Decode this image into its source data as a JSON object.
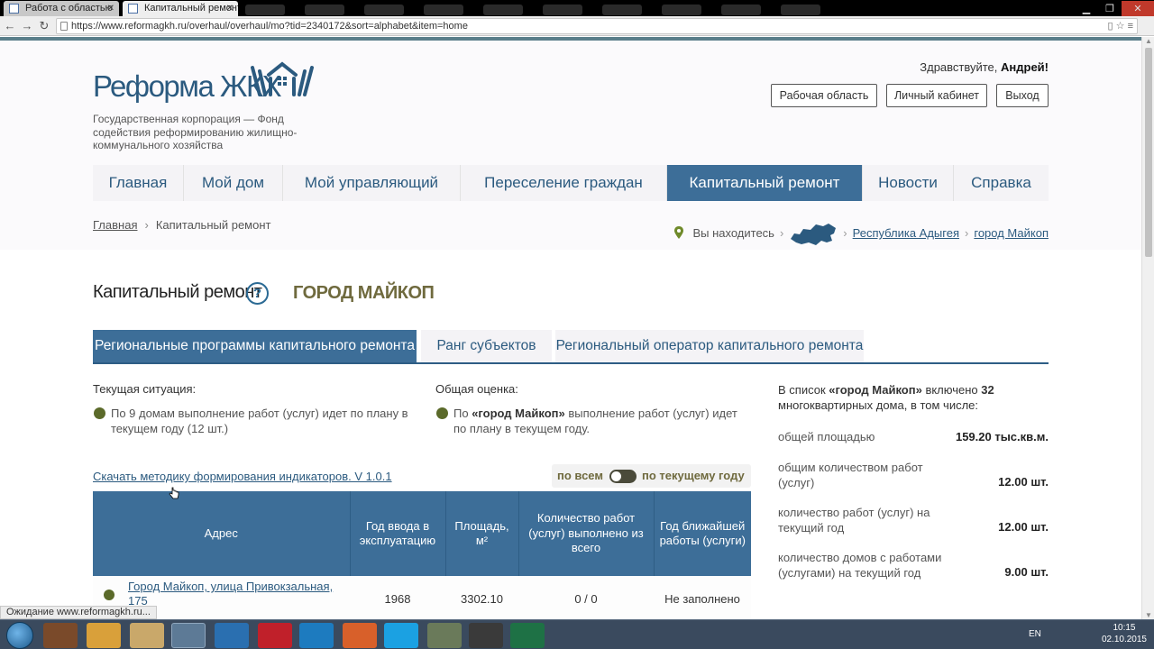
{
  "browser": {
    "tabs": [
      {
        "label": "Работа с областью",
        "active": false
      },
      {
        "label": "Капитальный ремонт",
        "active": true
      }
    ],
    "url": "https://www.reformagkh.ru/overhaul/overhaul/mo?tid=2340172&sort=alphabet&item=home",
    "status_text": "Ожидание www.reformagkh.ru..."
  },
  "header": {
    "logo_text": "Реформа ЖКХ",
    "tagline": "Государственная корпорация — Фонд содействия реформированию жилищно-коммунального хозяйства",
    "greeting_prefix": "Здравствуйте, ",
    "greeting_name": "Андрей!",
    "buttons": {
      "workspace": "Рабочая область",
      "cabinet": "Личный кабинет",
      "logout": "Выход"
    }
  },
  "nav": {
    "items": [
      "Главная",
      "Мой дом",
      "Мой управляющий",
      "Переселение граждан",
      "Капитальный ремонт",
      "Новости",
      "Справка"
    ],
    "active_index": 4
  },
  "breadcrumb": {
    "home": "Главная",
    "current": "Капитальный ремонт"
  },
  "location": {
    "label": "Вы находитесь",
    "region": "Республика Адыгея",
    "city": "город Майкоп"
  },
  "page": {
    "title": "Капитальный ремонт",
    "help_symbol": "?",
    "city_title": "ГОРОД МАЙКОП"
  },
  "tabs": [
    "Региональные программы капитального ремонта",
    "Ранг субъектов",
    "Региональный оператор капитального ремонта"
  ],
  "situation": {
    "current_label": "Текущая ситуация:",
    "current_text": "По 9 домам выполнение работ (услуг) идет по плану в текущем году (12 шт.)",
    "overall_label": "Общая оценка:",
    "overall_prefix": "По ",
    "overall_bold": "«город Майкоп»",
    "overall_suffix": " выполнение работ (услуг) идет по плану в текущем году."
  },
  "download_link": "Скачать методику формирования индикаторов. V 1.0.1",
  "toggle": {
    "left": "по всем",
    "right": "по текущему году"
  },
  "table": {
    "headers": [
      "Адрес",
      "Год ввода в эксплуатацию",
      "Площадь, м²",
      "Количество работ (услуг) выполнено из всего",
      "Год ближайшей работы (услуги)"
    ],
    "rows": [
      {
        "address": "Город Майкоп, улица Привокзальная, 175",
        "year": "1968",
        "area": "3302.10",
        "works": "0 / 0",
        "next": "Не заполнено"
      }
    ]
  },
  "summary": {
    "intro_prefix": "В список ",
    "intro_bold": "«город Майкоп»",
    "intro_mid": " включено ",
    "intro_count": "32",
    "intro_suffix": " многоквартирных дома, в том числе:",
    "stats": [
      {
        "label": "общей площадью",
        "value": "159.20 тыс.кв.м."
      },
      {
        "label": "общим количеством работ (услуг)",
        "value": "12.00 шт."
      },
      {
        "label": "количество работ (услуг) на текущий год",
        "value": "12.00 шт."
      },
      {
        "label": "количество домов с работами (услугами) на текущий год",
        "value": "9.00 шт."
      }
    ]
  },
  "taskbar": {
    "lang": "EN",
    "time": "10:15",
    "date": "02.10.2015"
  },
  "colors": {
    "brand_blue": "#2b5a7f",
    "nav_active": "#3d6e98",
    "status_dot": "#5b6a2a",
    "city_olive": "#6f6a3e"
  }
}
